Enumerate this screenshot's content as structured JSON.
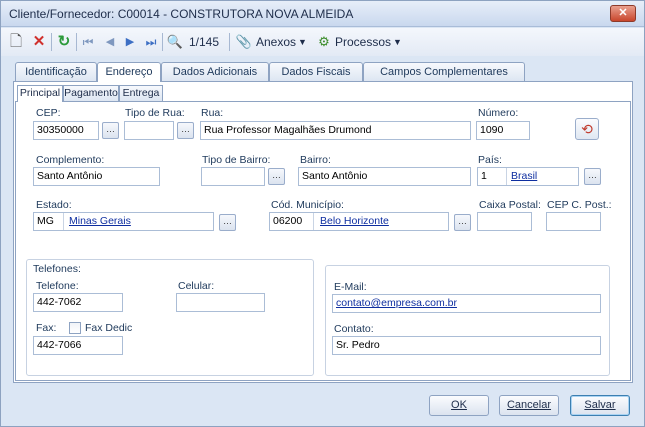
{
  "window": {
    "title": "Cliente/Fornecedor: C00014 - CONSTRUTORA NOVA ALMEIDA",
    "close_glyph": "✕"
  },
  "toolbar": {
    "icons": [
      "new-doc-icon",
      "delete-icon",
      "refresh-icon",
      "first-record-icon",
      "previous-record-icon",
      "next-record-icon",
      "last-record-icon",
      "search-icon",
      "attachment-icon",
      "processes-icon"
    ],
    "record_counter": "1/145",
    "anexos_label": "Anexos",
    "processos_label": "Processos"
  },
  "tabs_main": [
    {
      "label": "Identificação",
      "active": false
    },
    {
      "label": "Endereço",
      "active": true
    },
    {
      "label": "Dados Adicionais",
      "active": false
    },
    {
      "label": "Dados Fiscais",
      "active": false
    },
    {
      "label": "Campos Complementares",
      "active": false
    }
  ],
  "tabs_sub": [
    {
      "label": "Principal",
      "active": true
    },
    {
      "label": "Pagamento",
      "active": false
    },
    {
      "label": "Entrega",
      "active": false
    }
  ],
  "address": {
    "cep_label": "CEP:",
    "cep_value": "30350000",
    "tipo_rua_label": "Tipo de Rua:",
    "tipo_rua_value": "",
    "rua_label": "Rua:",
    "rua_value": "Rua Professor Magalhães Drumond",
    "numero_label": "Número:",
    "numero_value": "1090",
    "complemento_label": "Complemento:",
    "complemento_value": "Santo Antônio",
    "tipo_bairro_label": "Tipo de Bairro:",
    "tipo_bairro_value": "",
    "bairro_label": "Bairro:",
    "bairro_value": "Santo Antônio",
    "pais_label": "País:",
    "pais_code": "1",
    "pais_name": "Brasil",
    "estado_label": "Estado:",
    "estado_code": "MG",
    "estado_name": "Minas Gerais",
    "municipio_label": "Cód. Município:",
    "municipio_code": "06200",
    "municipio_name": "Belo Horizonte",
    "caixa_postal_label": "Caixa Postal:",
    "caixa_postal_value": "",
    "cep_cpost_label": "CEP C. Post.:",
    "cep_cpost_value": ""
  },
  "phones": {
    "group_label": "Telefones:",
    "telefone_label": "Telefone:",
    "telefone_value": "442-7062",
    "celular_label": "Celular:",
    "celular_value": "",
    "fax_label": "Fax:",
    "fax_dedic_label": "Fax Dedic",
    "fax_value": "442-7066"
  },
  "contact": {
    "email_label": "E-Mail:",
    "email_value": "contato@empresa.com.br",
    "contato_label": "Contato:",
    "contato_value": "Sr. Pedro"
  },
  "buttons": {
    "ok": "OK",
    "cancel": "Cancelar",
    "save": "Salvar"
  }
}
